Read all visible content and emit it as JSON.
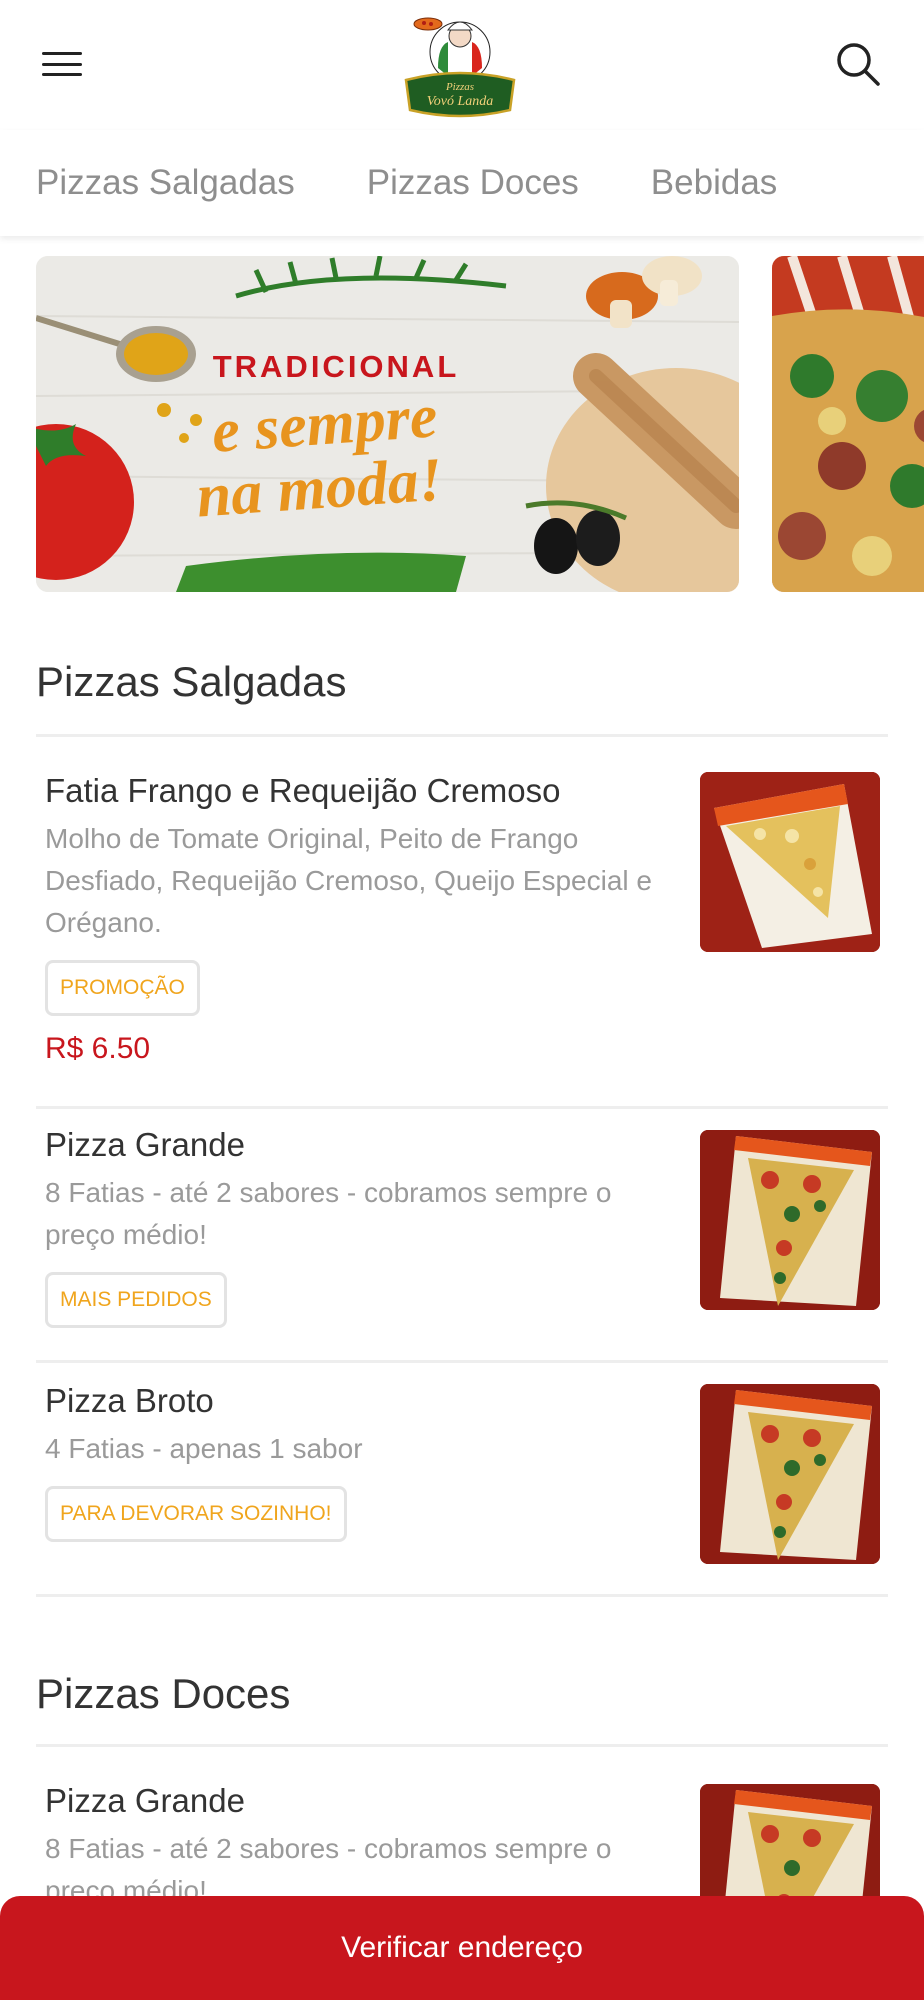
{
  "brand": {
    "logo_line1": "Pizzas",
    "logo_line2": "Vovó Landa"
  },
  "tabs": [
    {
      "label": "Pizzas Salgadas"
    },
    {
      "label": "Pizzas Doces"
    },
    {
      "label": "Bebidas"
    }
  ],
  "banners": [
    {
      "line1": "TRADICIONAL",
      "line2": "e sempre",
      "line3": "na moda!"
    }
  ],
  "sections": [
    {
      "title": "Pizzas Salgadas",
      "items": [
        {
          "name": "Fatia Frango e Requeijão Cremoso",
          "description": "Molho de Tomate Original, Peito de Frango Desfiado, Requeijão Cremoso, Queijo Especial e Orégano.",
          "badge": "PROMOÇÃO",
          "price": "R$ 6.50"
        },
        {
          "name": "Pizza Grande",
          "description": "8 Fatias - até 2 sabores - cobramos sempre o preço médio!",
          "badge": "MAIS PEDIDOS"
        },
        {
          "name": "Pizza Broto",
          "description": "4 Fatias - apenas 1 sabor",
          "badge": "PARA DEVORAR SOZINHO!"
        }
      ]
    },
    {
      "title": "Pizzas Doces",
      "items": [
        {
          "name": "Pizza Grande",
          "description": "8 Fatias - até 2 sabores - cobramos sempre o preço médio!"
        }
      ]
    }
  ],
  "bottom_button": {
    "label": "Verificar endereço"
  },
  "icons": {
    "menu": "hamburger-menu-icon",
    "search": "search-icon"
  },
  "colors": {
    "accent": "#c8161d",
    "badge_text": "#f0a51d",
    "banner_text_red": "#c8161d",
    "banner_text_orange": "#e8941e"
  }
}
